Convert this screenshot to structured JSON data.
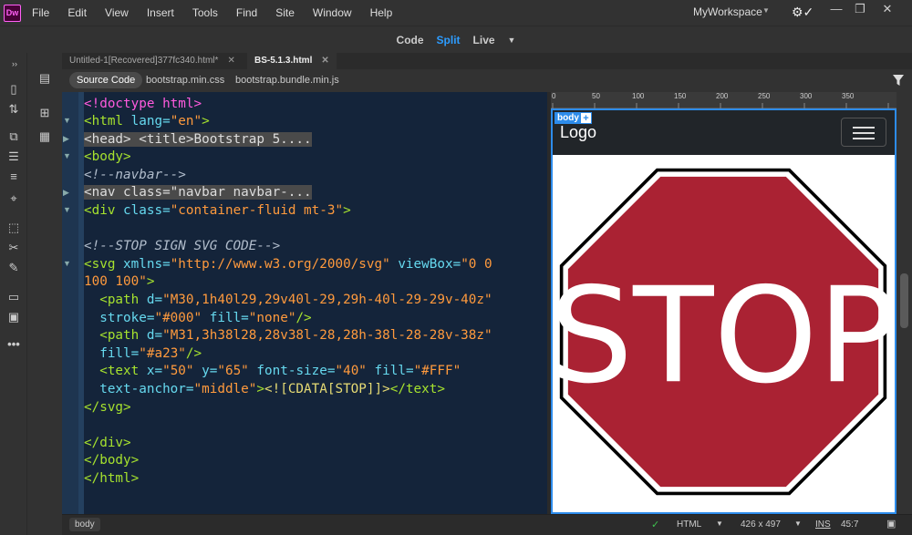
{
  "app": {
    "logo": "Dw",
    "menu": [
      "File",
      "Edit",
      "View",
      "Insert",
      "Tools",
      "Find",
      "Site",
      "Window",
      "Help"
    ],
    "workspace": "MyWorkspace"
  },
  "views": {
    "code": "Code",
    "split": "Split",
    "live": "Live"
  },
  "tabs": [
    {
      "label": "Untitled-1[Recovered]377fc340.html*",
      "close": "✕"
    },
    {
      "label": "BS-5.1.3.html",
      "close": "✕"
    }
  ],
  "related": {
    "source": "Source Code",
    "files": [
      "bootstrap.min.css",
      "bootstrap.bundle.min.js"
    ]
  },
  "code": {
    "l1": "<!doctype html>",
    "l2a": "<html ",
    "l2b": "lang=",
    "l2c": "\"en\"",
    "l2d": ">",
    "l3": "<head> <title>Bootstrap 5....",
    "l4": "<body>",
    "l5": "<!--navbar-->",
    "l6": "<nav class=\"navbar navbar-...",
    "l7a": "<div ",
    "l7b": "class=",
    "l7c": "\"container-fluid mt-3\"",
    "l7d": ">",
    "l9": "<!--STOP SIGN SVG CODE-->",
    "l10a": "<svg ",
    "l10b": "xmlns=",
    "l10c": "\"http://www.w3.org/2000/svg\"",
    "l10d": " viewBox=",
    "l10e": "\"0 0",
    "l11a": "100 100\"",
    "l11b": ">",
    "l12a": "  <path ",
    "l12b": "d=",
    "l12c": "\"M30,1h40l29,29v40l-29,29h-40l-29-29v-40z\"",
    "l13a": "  stroke=",
    "l13b": "\"#000\"",
    "l13c": " fill=",
    "l13d": "\"none\"",
    "l13e": "/>",
    "l14a": "  <path ",
    "l14b": "d=",
    "l14c": "\"M31,3h38l28,28v38l-28,28h-38l-28-28v-38z\"",
    "l15a": "  fill=",
    "l15b": "\"#a23\"",
    "l15c": "/>",
    "l16a": "  <text ",
    "l16b": "x=",
    "l16c": "\"50\"",
    "l16d": " y=",
    "l16e": "\"65\"",
    "l16f": " font-size=",
    "l16g": "\"40\"",
    "l16h": " fill=",
    "l16i": "\"#FFF\"",
    "l17a": "  text-anchor=",
    "l17b": "\"middle\"",
    "l17c": ">",
    "l17d": "<![CDATA[STOP]]>",
    "l17e": "</text>",
    "l18": "</svg>",
    "l20": "</div>",
    "l21": "</body>",
    "l22": "</html>"
  },
  "ruler": [
    "0",
    "50",
    "100",
    "150",
    "200",
    "250",
    "300",
    "350"
  ],
  "live": {
    "body_tag": "body",
    "plus": "+",
    "logo": "Logo",
    "stop_text": "STOP",
    "stop_fill": "#a23",
    "stroke": "#000"
  },
  "status": {
    "tag": "body",
    "doctype": "HTML",
    "size": "426 x 497",
    "mode": "INS",
    "position": "45:7"
  }
}
